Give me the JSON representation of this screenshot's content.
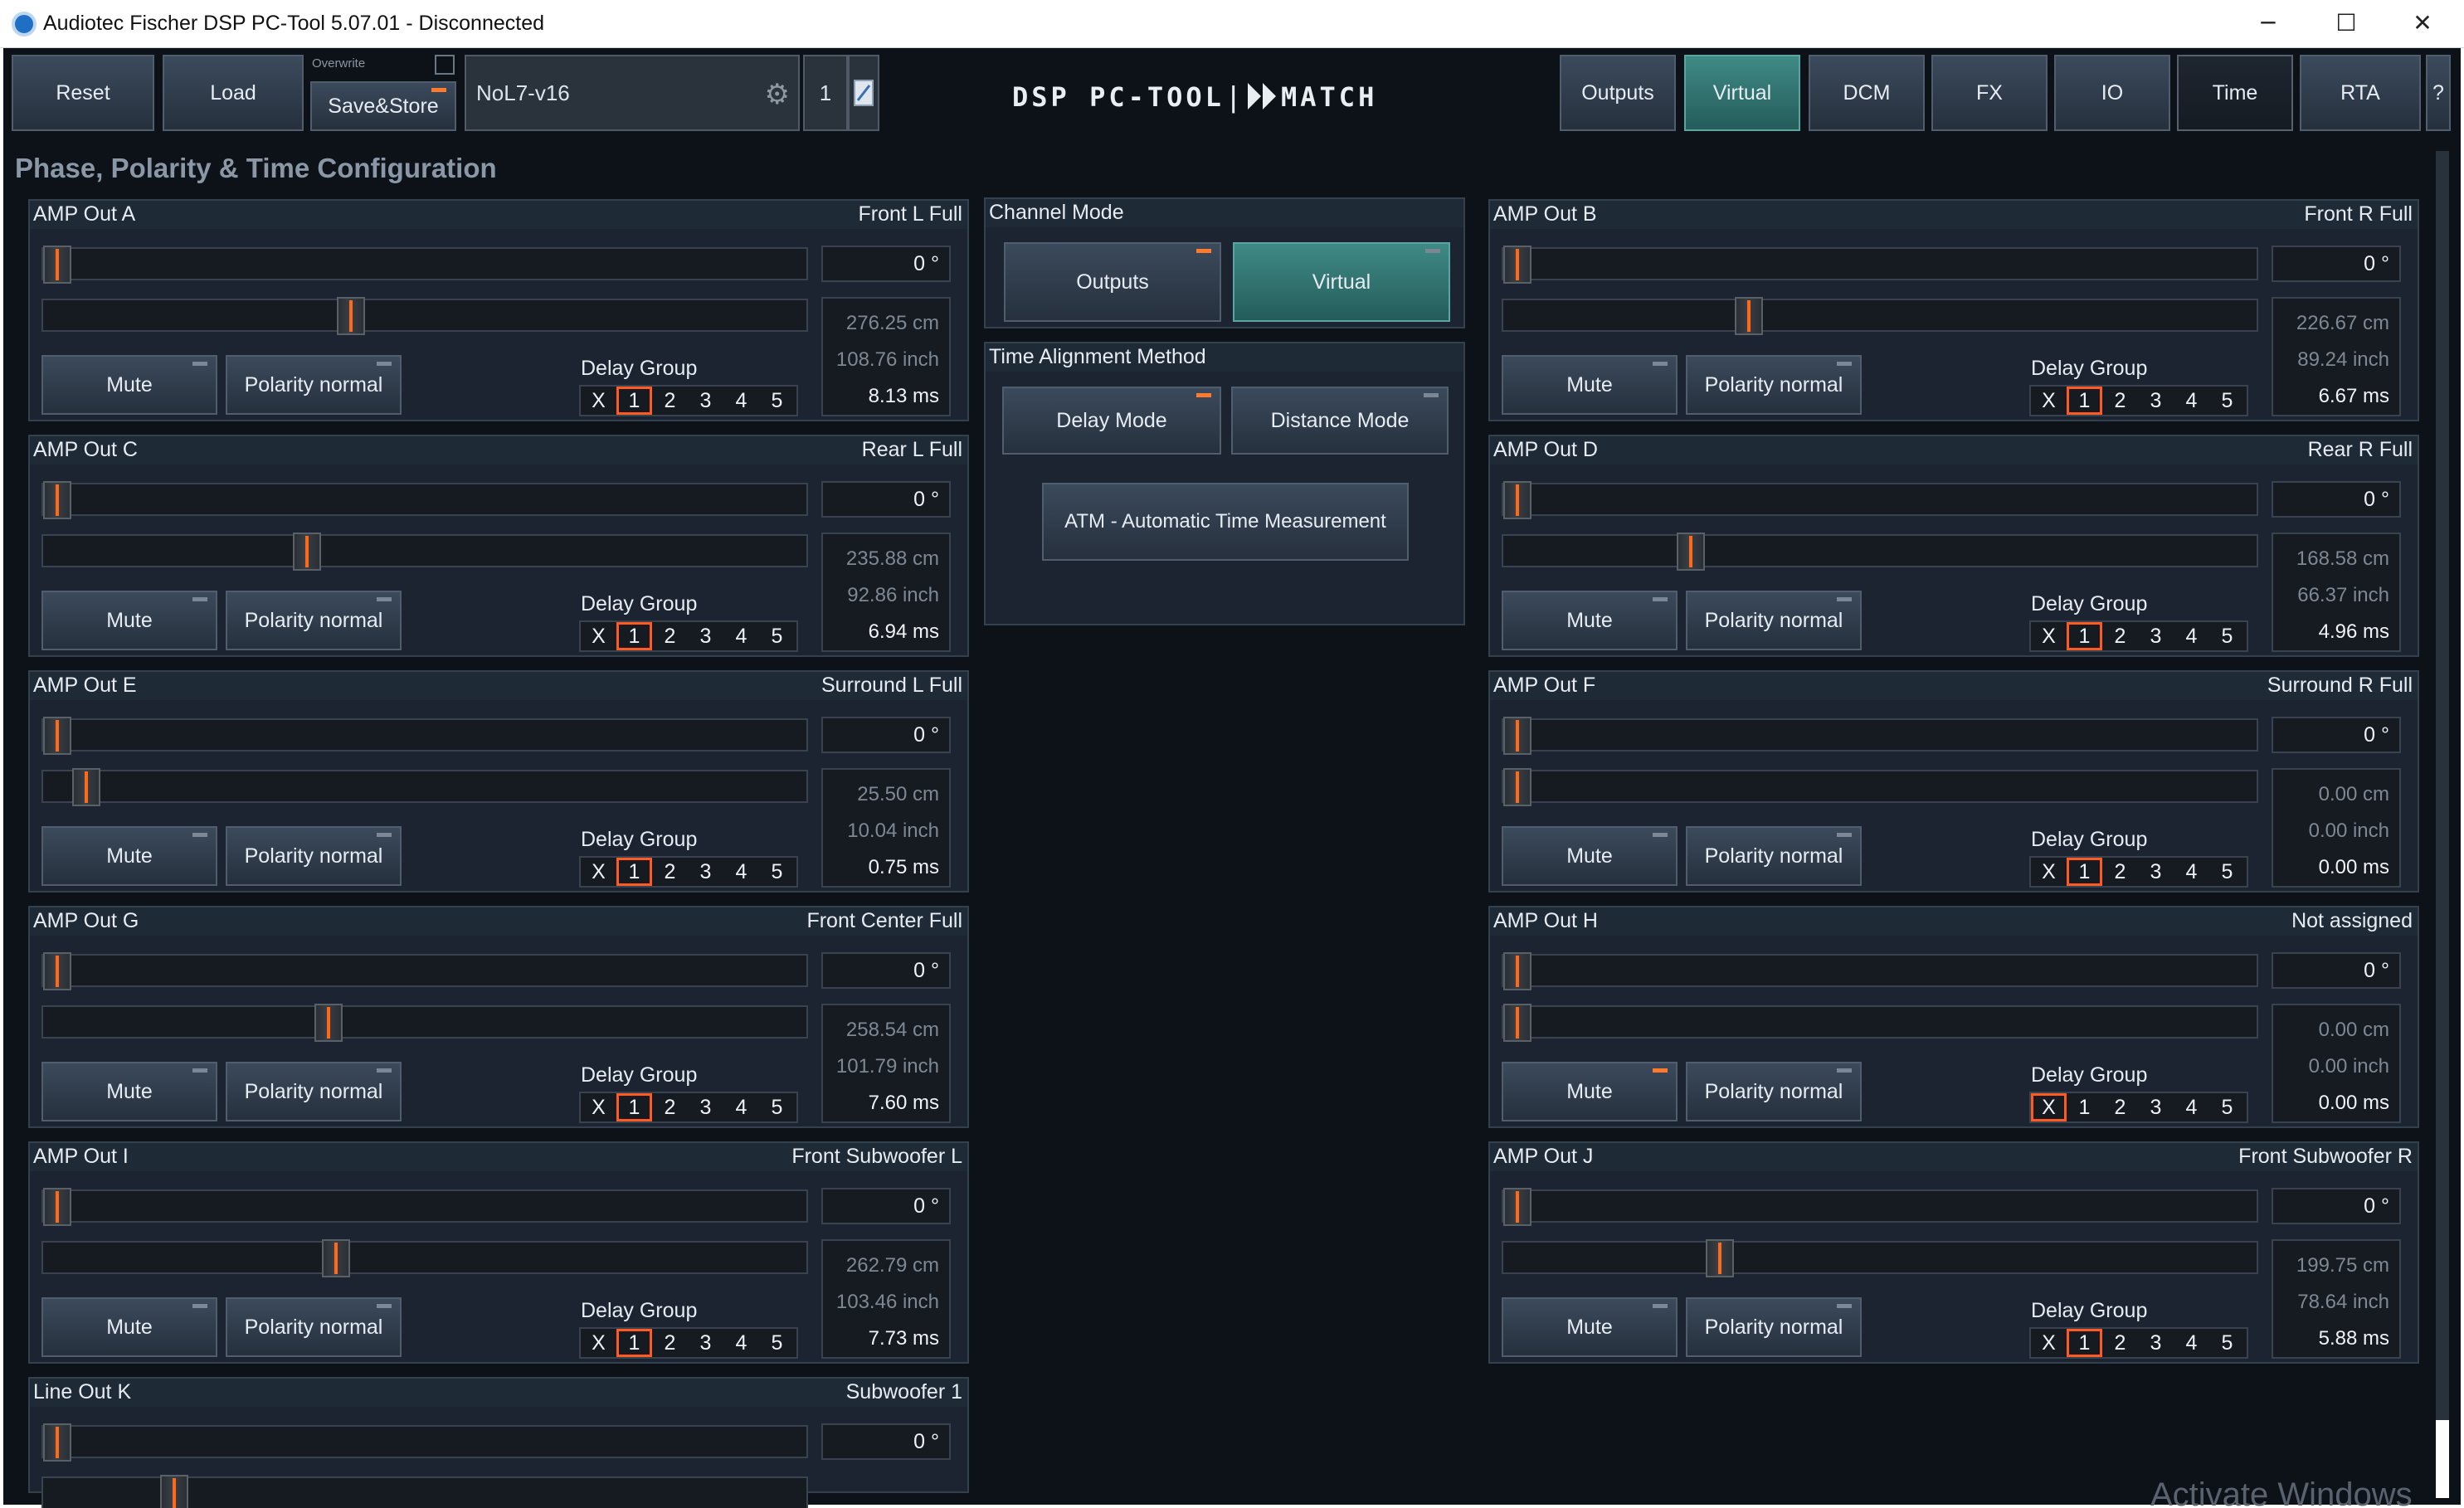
{
  "window": {
    "title": "Audiotec Fischer DSP PC-Tool 5.07.01 - Disconnected",
    "minimize": "─",
    "maximize": "☐",
    "close": "✕"
  },
  "toolbar": {
    "reset": "Reset",
    "load": "Load",
    "overwrite": "Overwrite",
    "save_store": "Save&Store",
    "preset_name": "NoL7-v16",
    "preset_slot": "1",
    "logo_left": "DSP PC-TOOL",
    "logo_sep": "|",
    "logo_right": "MATCH",
    "tabs": [
      "Outputs",
      "Virtual",
      "DCM",
      "FX",
      "IO",
      "Time",
      "RTA"
    ],
    "help": "?"
  },
  "page_title": "Phase, Polarity & Time Configuration",
  "common": {
    "mute": "Mute",
    "polarity": "Polarity normal",
    "delay_group": "Delay Group",
    "groups": [
      "X",
      "1",
      "2",
      "3",
      "4",
      "5"
    ]
  },
  "channels": [
    {
      "id": "a",
      "name": "AMP Out A",
      "assign": "Front L Full",
      "phase": "0 °",
      "cm": "276.25 cm",
      "inch": "108.76 inch",
      "ms": "8.13 ms",
      "group": 1,
      "mute_on": false,
      "delay_pos": 0.4
    },
    {
      "id": "b",
      "name": "AMP Out B",
      "assign": "Front R Full",
      "phase": "0 °",
      "cm": "226.67 cm",
      "inch": "89.24 inch",
      "ms": "6.67 ms",
      "group": 1,
      "mute_on": false,
      "delay_pos": 0.32
    },
    {
      "id": "c",
      "name": "AMP Out C",
      "assign": "Rear L Full",
      "phase": "0 °",
      "cm": "235.88 cm",
      "inch": "92.86 inch",
      "ms": "6.94 ms",
      "group": 1,
      "mute_on": false,
      "delay_pos": 0.34
    },
    {
      "id": "d",
      "name": "AMP Out D",
      "assign": "Rear R Full",
      "phase": "0 °",
      "cm": "168.58 cm",
      "inch": "66.37 inch",
      "ms": "4.96 ms",
      "group": 1,
      "mute_on": false,
      "delay_pos": 0.24
    },
    {
      "id": "e",
      "name": "AMP Out E",
      "assign": "Surround L Full",
      "phase": "0 °",
      "cm": "25.50 cm",
      "inch": "10.04 inch",
      "ms": "0.75 ms",
      "group": 1,
      "mute_on": false,
      "delay_pos": 0.04
    },
    {
      "id": "f",
      "name": "AMP Out F",
      "assign": "Surround R Full",
      "phase": "0 °",
      "cm": "0.00 cm",
      "inch": "0.00 inch",
      "ms": "0.00 ms",
      "group": 1,
      "mute_on": false,
      "delay_pos": 0.0
    },
    {
      "id": "g",
      "name": "AMP Out G",
      "assign": "Front Center Full",
      "phase": "0 °",
      "cm": "258.54 cm",
      "inch": "101.79 inch",
      "ms": "7.60 ms",
      "group": 1,
      "mute_on": false,
      "delay_pos": 0.37
    },
    {
      "id": "h",
      "name": "AMP Out H",
      "assign": "Not assigned",
      "phase": "0 °",
      "cm": "0.00 cm",
      "inch": "0.00 inch",
      "ms": "0.00 ms",
      "group": 0,
      "mute_on": true,
      "delay_pos": 0.0
    },
    {
      "id": "i",
      "name": "AMP Out I",
      "assign": "Front Subwoofer L",
      "phase": "0 °",
      "cm": "262.79 cm",
      "inch": "103.46 inch",
      "ms": "7.73 ms",
      "group": 1,
      "mute_on": false,
      "delay_pos": 0.38
    },
    {
      "id": "j",
      "name": "AMP Out J",
      "assign": "Front Subwoofer R",
      "phase": "0 °",
      "cm": "199.75 cm",
      "inch": "78.64 inch",
      "ms": "5.88 ms",
      "group": 1,
      "mute_on": false,
      "delay_pos": 0.28
    },
    {
      "id": "k",
      "name": "Line Out K",
      "assign": "Subwoofer 1",
      "phase": "0 °",
      "delay_pos": 0.16
    }
  ],
  "channel_mode": {
    "title": "Channel Mode",
    "outputs": "Outputs",
    "virtual": "Virtual"
  },
  "time_alignment": {
    "title": "Time Alignment Method",
    "delay_mode": "Delay Mode",
    "distance_mode": "Distance Mode",
    "atm": "ATM - Automatic Time Measurement"
  },
  "watermark": "Activate Windows",
  "colors": {
    "background": "#0d1218",
    "panel": "#1b2430",
    "accent_orange": "#ff6a1a",
    "teal_active": "#3f8a86"
  }
}
